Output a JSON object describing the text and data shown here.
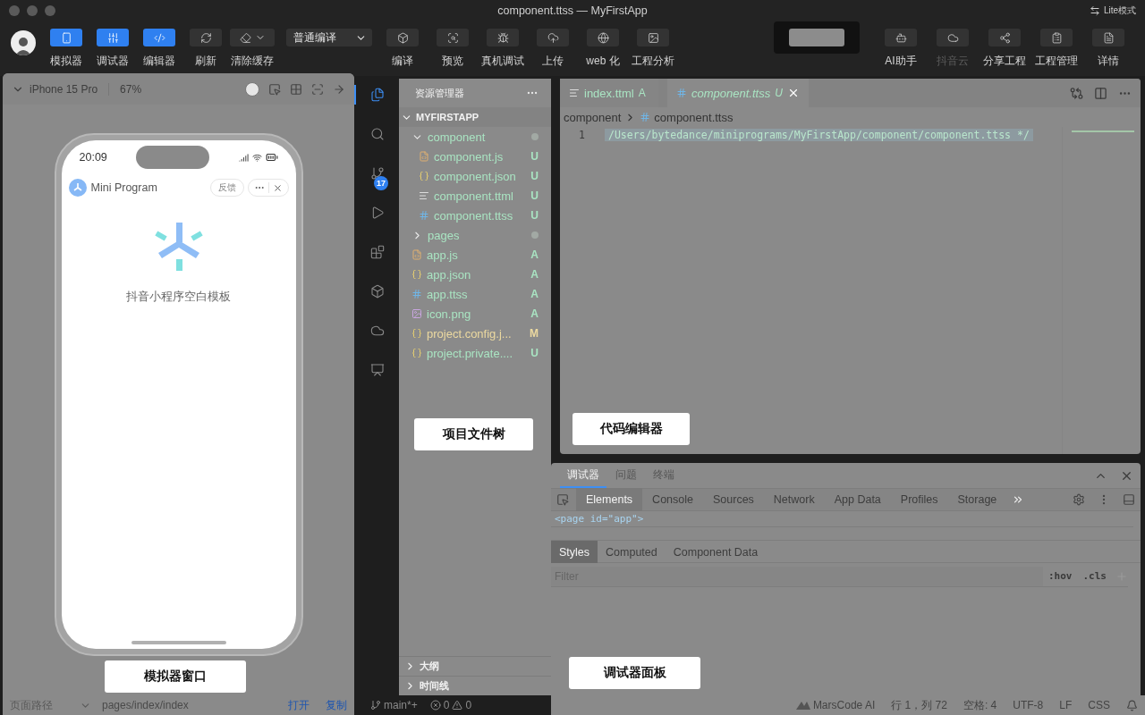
{
  "window": {
    "title": "component.ttss — MyFirstApp",
    "mode_label": "Lite模式"
  },
  "toolbar": {
    "left_buttons": [
      {
        "label": "模拟器",
        "kind": "phone",
        "active": true,
        "has_menu": false
      },
      {
        "label": "调试器",
        "kind": "sliders",
        "active": true,
        "has_menu": false
      },
      {
        "label": "编辑器",
        "kind": "code",
        "active": true,
        "has_menu": false
      },
      {
        "label": "刷新",
        "kind": "refresh",
        "active": false,
        "has_menu": false
      },
      {
        "label": "清除缓存",
        "kind": "eraser",
        "active": false,
        "has_menu": true
      }
    ],
    "compile_select": {
      "value": "普通编译"
    },
    "center_buttons": [
      {
        "label": "编译",
        "kind": "box",
        "disabled": false
      },
      {
        "label": "预览",
        "kind": "scan",
        "disabled": false
      },
      {
        "label": "真机调试",
        "kind": "bug",
        "disabled": false
      },
      {
        "label": "上传",
        "kind": "upload",
        "disabled": false
      },
      {
        "label": "web 化",
        "kind": "globe",
        "disabled": false
      },
      {
        "label": "工程分析",
        "kind": "image",
        "disabled": false
      }
    ],
    "right_buttons": [
      {
        "label": "AI助手",
        "kind": "bot",
        "disabled": false
      },
      {
        "label": "抖音云",
        "kind": "cloud",
        "disabled": true
      },
      {
        "label": "分享工程",
        "kind": "share",
        "disabled": false
      },
      {
        "label": "工程管理",
        "kind": "clipboard",
        "disabled": false
      },
      {
        "label": "详情",
        "kind": "file",
        "disabled": false
      }
    ]
  },
  "simulator": {
    "device": "iPhone 15 Pro",
    "zoom": "67%",
    "time": "20:09",
    "app_title": "Mini Program",
    "feedback": "反馈",
    "page_text": "抖音小程序空白模板",
    "footer": {
      "label": "页面路径",
      "path": "pages/index/index",
      "open": "打开",
      "copy": "复制"
    }
  },
  "activity_bar": [
    {
      "kind": "files",
      "selected": true
    },
    {
      "kind": "search",
      "selected": false
    },
    {
      "kind": "git",
      "selected": false,
      "badge": "17"
    },
    {
      "kind": "debug",
      "selected": false
    },
    {
      "kind": "blocks",
      "selected": false
    },
    {
      "kind": "box",
      "selected": false
    },
    {
      "kind": "cloud",
      "selected": false
    },
    {
      "kind": "monitor",
      "selected": false
    }
  ],
  "explorer": {
    "title": "资源管理器",
    "root": {
      "label": "MYFIRSTAPP",
      "expanded": true
    },
    "tree": [
      {
        "label": "component",
        "kind": "folder",
        "expanded": true,
        "modified": true,
        "children": [
          {
            "label": "component.js",
            "kind": "js",
            "status": "U"
          },
          {
            "label": "component.json",
            "kind": "json",
            "status": "U"
          },
          {
            "label": "component.ttml",
            "kind": "ttml",
            "status": "U"
          },
          {
            "label": "component.ttss",
            "kind": "ttss",
            "status": "U"
          }
        ]
      },
      {
        "label": "pages",
        "kind": "folder",
        "expanded": false,
        "modified": true
      },
      {
        "label": "app.js",
        "kind": "js",
        "status": "A"
      },
      {
        "label": "app.json",
        "kind": "json",
        "status": "A"
      },
      {
        "label": "app.ttss",
        "kind": "ttss",
        "status": "A"
      },
      {
        "label": "icon.png",
        "kind": "png",
        "status": "A"
      },
      {
        "label": "project.config.j...",
        "kind": "json",
        "status": "M"
      },
      {
        "label": "project.private....",
        "kind": "json",
        "status": "U"
      }
    ],
    "sections": [
      {
        "label": "大纲",
        "expanded": false
      },
      {
        "label": "时间线",
        "expanded": false
      }
    ]
  },
  "editor": {
    "tabs": [
      {
        "label": "index.ttml",
        "kind": "ttml",
        "status": "A",
        "selected": false
      },
      {
        "label": "component.ttss",
        "kind": "ttss",
        "status": "U",
        "selected": true
      }
    ],
    "breadcrumb": [
      "component",
      "component.ttss"
    ],
    "lines": [
      {
        "number": "1",
        "text": "/Users/bytedance/miniprograms/MyFirstApp/component/component.ttss */"
      }
    ]
  },
  "debugger": {
    "tabs": [
      {
        "label": "调试器",
        "selected": true
      },
      {
        "label": "问题",
        "selected": false
      },
      {
        "label": "终端",
        "selected": false
      }
    ],
    "devtools_tabs": [
      {
        "label": "Elements",
        "selected": true
      },
      {
        "label": "Console",
        "selected": false
      },
      {
        "label": "Sources",
        "selected": false
      },
      {
        "label": "Network",
        "selected": false
      },
      {
        "label": "App Data",
        "selected": false
      },
      {
        "label": "Profiles",
        "selected": false
      },
      {
        "label": "Storage",
        "selected": false
      }
    ],
    "dom_line": "<page id=\"app\">",
    "style_tabs": [
      {
        "label": "Styles",
        "selected": true
      },
      {
        "label": "Computed",
        "selected": false
      },
      {
        "label": "Component Data",
        "selected": false
      }
    ],
    "filter": {
      "placeholder": "Filter"
    },
    "hov": ":hov",
    "cls": ".cls"
  },
  "status_bar": {
    "branch": "main*+",
    "errors": "0",
    "warnings": "0",
    "ai": "MarsCode AI",
    "items": [
      "行 1，列 72",
      "空格: 4",
      "UTF-8",
      "LF",
      "CSS"
    ]
  },
  "callouts": [
    {
      "label": "模拟器窗口"
    },
    {
      "label": "项目文件树"
    },
    {
      "label": "代码编辑器"
    },
    {
      "label": "调试器面板"
    }
  ]
}
